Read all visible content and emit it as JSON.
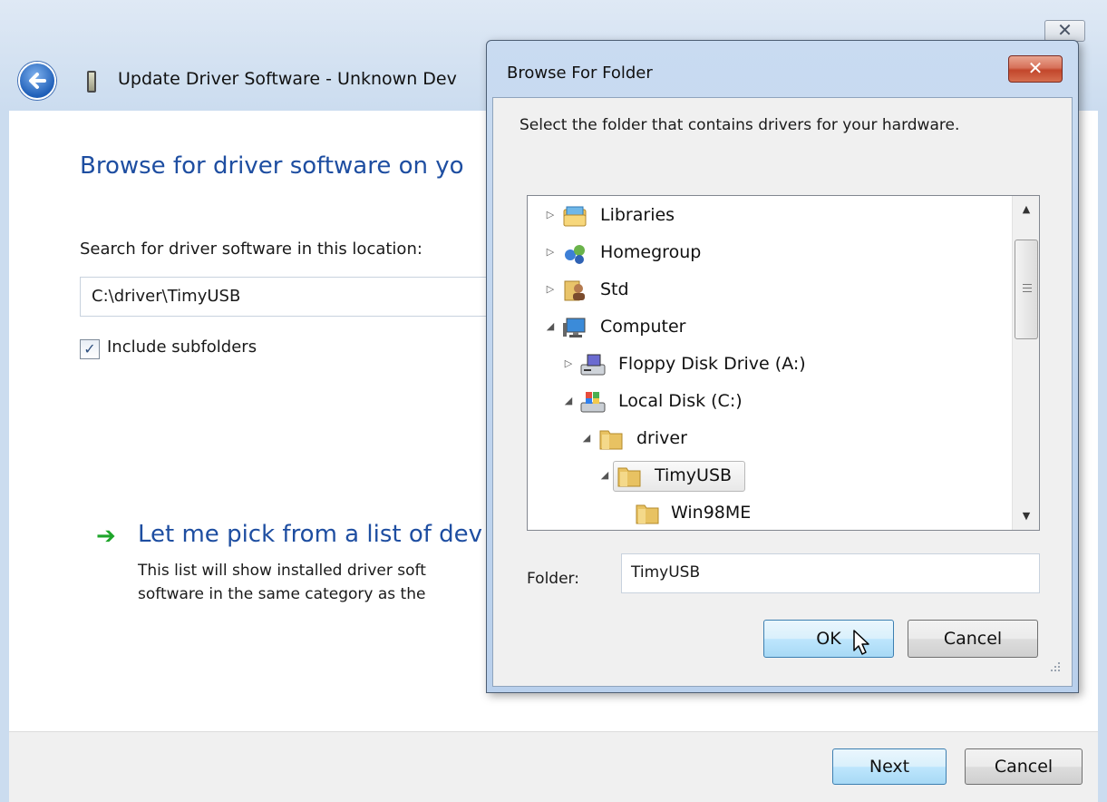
{
  "wizard": {
    "title": "Update Driver Software - Unknown Dev",
    "heading": "Browse for driver software on yo",
    "search_label": "Search for driver software in this location:",
    "path_value": "C:\\driver\\TimyUSB",
    "include_subfolders_label": "Include subfolders",
    "include_subfolders_checked": true,
    "pick_title": "Let me pick from a list of dev",
    "pick_desc_line1": "This list will show installed driver soft",
    "pick_desc_line2": "software in the same category as the",
    "next_label": "Next",
    "cancel_label": "Cancel",
    "close_glyph": "✕"
  },
  "dialog": {
    "title": "Browse For Folder",
    "close_glyph": "✕",
    "prompt": "Select the folder that contains drivers for your hardware.",
    "tree": [
      {
        "label": "Libraries",
        "icon": "libraries-icon",
        "expander": "collapsed"
      },
      {
        "label": "Homegroup",
        "icon": "homegroup-icon",
        "expander": "collapsed"
      },
      {
        "label": "Std",
        "icon": "user-folder-icon",
        "expander": "collapsed"
      },
      {
        "label": "Computer",
        "icon": "computer-icon",
        "expander": "expanded"
      },
      {
        "label": "Floppy Disk Drive (A:)",
        "icon": "floppy-drive-icon",
        "expander": "collapsed"
      },
      {
        "label": "Local Disk (C:)",
        "icon": "local-disk-icon",
        "expander": "expanded"
      },
      {
        "label": "driver",
        "icon": "folder-icon",
        "expander": "expanded"
      },
      {
        "label": "TimyUSB",
        "icon": "folder-icon",
        "expander": "expanded",
        "selected": true
      },
      {
        "label": "Win98ME",
        "icon": "folder-icon",
        "expander": "none"
      }
    ],
    "folder_label": "Folder:",
    "folder_value": "TimyUSB",
    "ok_label": "OK",
    "cancel_label": "Cancel"
  },
  "colors": {
    "heading_blue": "#1e4ea1",
    "arrow_green": "#1ea52a",
    "dialog_frame": "#c9dbf1"
  }
}
